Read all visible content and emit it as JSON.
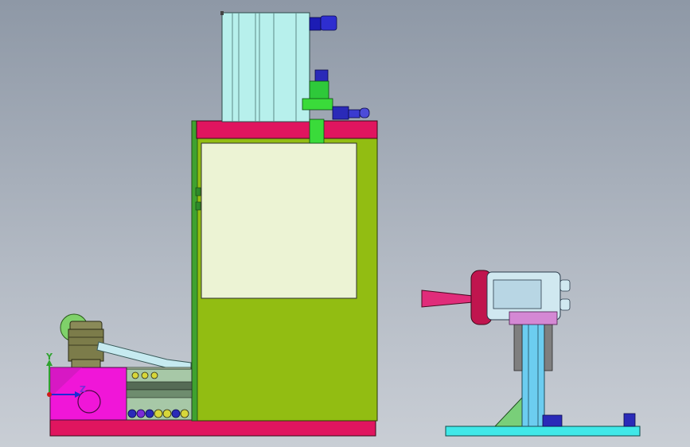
{
  "viewport": {
    "background_top": "#8e98a6",
    "background_bottom": "#c9ced5"
  },
  "triad": {
    "y_label": "Y",
    "z_label": "Z",
    "y_color": "#2fa32f",
    "z_color": "#1a2bd6",
    "origin_color": "#d11a1a",
    "z_text_color": "#7b2bd6"
  },
  "colors": {
    "cabinet_body": "#92bd12",
    "cabinet_top_band": "#e0155f",
    "cabinet_window": "#ecf3d4",
    "cylinder": "#b7f0ec",
    "base_plate": "#e0155f",
    "pink_block": "#f016d8",
    "fixture_plate": "#40e8e8",
    "head_red": "#c0154e"
  },
  "icons": {
    "triad": "coordinate-triad-icon"
  }
}
